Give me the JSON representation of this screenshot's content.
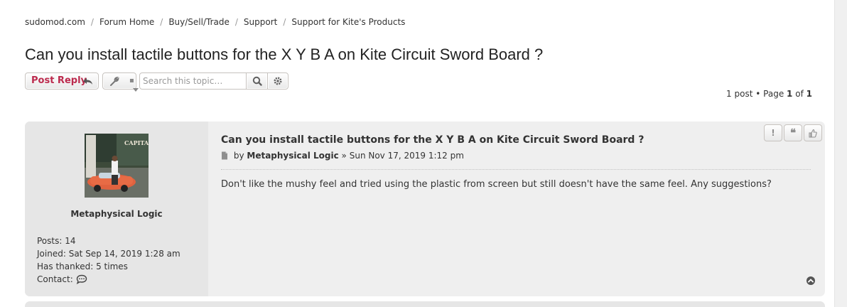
{
  "breadcrumbs": [
    {
      "label": "sudomod.com"
    },
    {
      "label": "Forum Home"
    },
    {
      "label": "Buy/Sell/Trade"
    },
    {
      "label": "Support"
    },
    {
      "label": "Support for Kite's Products"
    }
  ],
  "topic": {
    "title": "Can you install tactile buttons for the X Y B A on Kite Circuit Sword Board ?"
  },
  "action_bar": {
    "post_reply_label": "Post Reply",
    "search_placeholder": "Search this topic…",
    "icons": {
      "reply": "reply-icon",
      "tools": "wrench-icon",
      "search": "search-icon",
      "advanced": "gear-icon"
    }
  },
  "pagination": {
    "post_count": "1 post",
    "page_word": "Page",
    "current_page": "1",
    "of_word": "of",
    "total_pages": "1"
  },
  "post": {
    "title": "Can you install tactile buttons for the X Y B A on Kite Circuit Sword Board ?",
    "by_word": "by",
    "author": "Metaphysical Logic",
    "date": "Sun Nov 17, 2019 1:12 pm",
    "content": "Don't like the mushy feel and tried using the plastic from screen but still doesn't have the same feel. Any suggestions?",
    "buttons": [
      {
        "icon": "report-icon"
      },
      {
        "icon": "quote-icon"
      },
      {
        "icon": "thumbs-up-icon"
      }
    ]
  },
  "profile": {
    "username": "Metaphysical Logic",
    "avatar_text": "CAPITAL",
    "posts_label": "Posts:",
    "posts": "14",
    "joined_label": "Joined:",
    "joined": "Sat Sep 14, 2019 1:28 am",
    "thanked_label": "Has thanked:",
    "thanked": "5 times",
    "contact_label": "Contact:",
    "contact_icon": "speech-bubble-icon"
  },
  "colors": {
    "accent": "#bc2a4d",
    "post_bg": "#efefef",
    "profile_bg": "#e6e6e6"
  }
}
